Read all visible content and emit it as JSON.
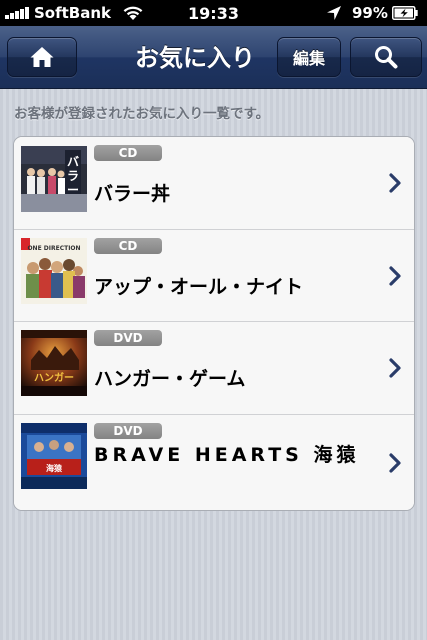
{
  "status_bar": {
    "carrier": "SoftBank",
    "time": "19:33",
    "battery": "99%"
  },
  "nav": {
    "title": "お気に入り",
    "edit_label": "編集",
    "home_icon": "home-icon",
    "search_icon": "search-icon"
  },
  "description": "お客様が登録されたお気に入り一覧です。",
  "favorites": [
    {
      "type": "CD",
      "title": "バラー丼",
      "art": "cd-cover-bara-don"
    },
    {
      "type": "CD",
      "title": "アップ・オール・ナイト",
      "art": "cd-cover-one-direction"
    },
    {
      "type": "DVD",
      "title": "ハンガー・ゲーム",
      "art": "dvd-cover-hunger-games"
    },
    {
      "type": "DVD",
      "title": "BRAVE HEARTS 海猿",
      "art": "dvd-cover-brave-hearts"
    }
  ],
  "colors": {
    "nav_bar": "#2e4470",
    "background": "#cdd2da",
    "badge": "#919191",
    "chevron": "#2a3c69"
  }
}
